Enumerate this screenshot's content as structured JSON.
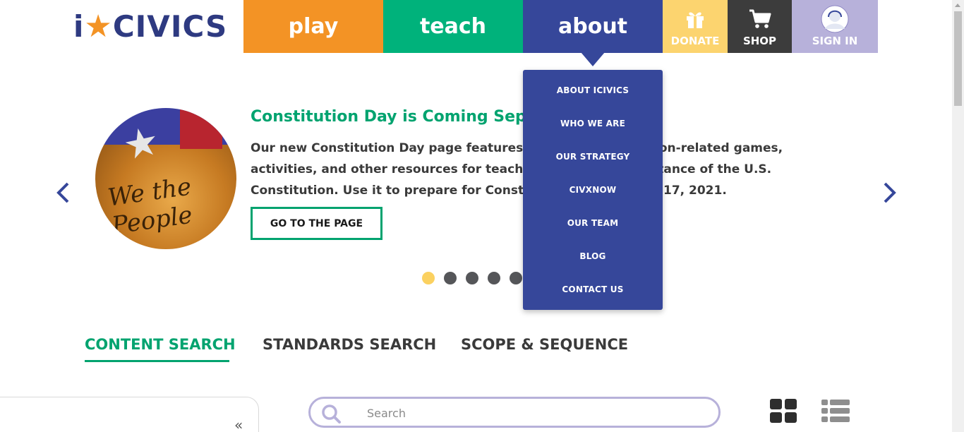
{
  "logo": {
    "text_pre": "i",
    "text_star": "★",
    "text_post": "CIVICS"
  },
  "nav": {
    "play": "play",
    "teach": "teach",
    "about": "about",
    "donate": "DONATE",
    "shop": "SHOP",
    "sign_in": "SIGN IN"
  },
  "about_menu": {
    "items": [
      "ABOUT ICIVICS",
      "WHO WE ARE",
      "OUR STRATEGY",
      "CIVXNOW",
      "OUR TEAM",
      "BLOG",
      "CONTACT US"
    ]
  },
  "carousel": {
    "slide": {
      "title": "Constitution Day is Coming September 17!",
      "body": "Our new Constitution Day page features all of our Constitution-related games, activities, and other resources for teaching about the importance of the U.S. Constitution. Use it to prepare for Constitution Day on Sept. 17, 2021.",
      "image_text": "We the People",
      "button": "GO TO THE PAGE"
    },
    "dots_count": 5,
    "active_dot": 0
  },
  "search_tabs": {
    "content": "CONTENT SEARCH",
    "standards": "STANDARDS SEARCH",
    "scope": "SCOPE & SEQUENCE",
    "active": "content"
  },
  "search": {
    "placeholder": "Search",
    "value": ""
  },
  "sidebar": {
    "collapse_glyph": "«"
  },
  "icons": {
    "donate": "gift-icon",
    "shop": "cart-icon",
    "sign_in": "user-avatar-icon",
    "prev": "chevron-left-icon",
    "next": "chevron-right-icon",
    "search": "search-icon",
    "grid": "grid-view-icon",
    "list": "list-view-icon"
  },
  "colors": {
    "play": "#f39325",
    "teach": "#00b27b",
    "about": "#36479a",
    "donate": "#fcd46f",
    "shop": "#3c3c3c",
    "sign_in": "#b7b1da",
    "accent_green": "#00a36f",
    "active_dot": "#fbd160"
  }
}
